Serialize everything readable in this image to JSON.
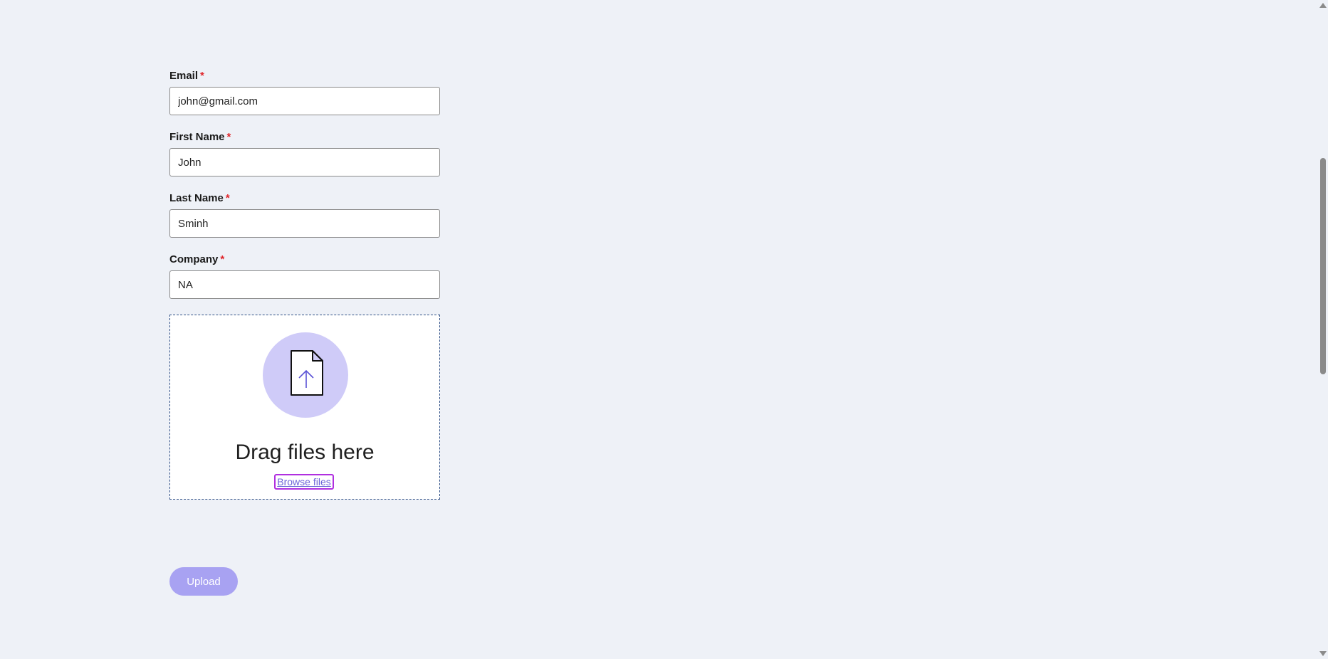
{
  "form": {
    "fields": [
      {
        "label": "Email",
        "required_mark": "*",
        "value": "john@gmail.com"
      },
      {
        "label": "First Name",
        "required_mark": "*",
        "value": "John"
      },
      {
        "label": "Last Name",
        "required_mark": "*",
        "value": "Sminh"
      },
      {
        "label": "Company",
        "required_mark": "*",
        "value": "NA"
      }
    ],
    "dropzone": {
      "icon": "file-upload-icon",
      "text": "Drag files here",
      "browse_label": "Browse files"
    },
    "upload_label": "Upload"
  },
  "colors": {
    "background": "#eef1f7",
    "required": "#e0262b",
    "accent": "#a8a2f2",
    "icon_circle": "#cfcbf8",
    "browse_focus": "#b02fe0"
  }
}
